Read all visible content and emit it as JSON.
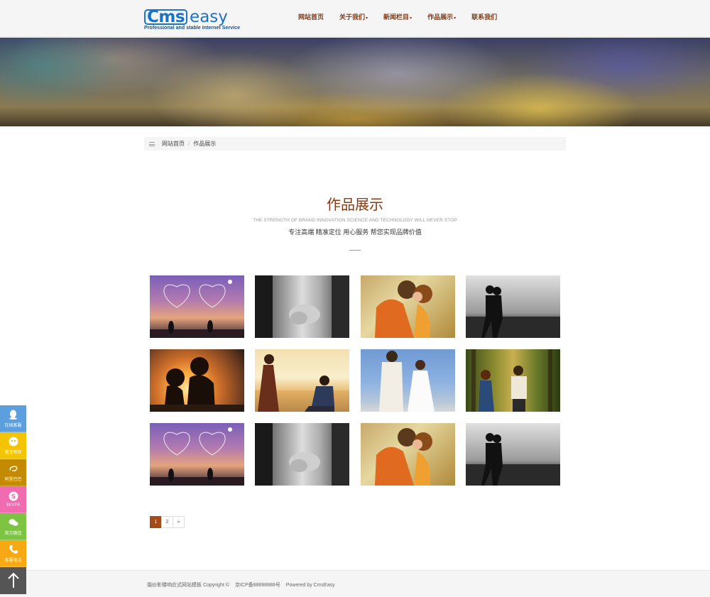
{
  "logo": {
    "brand_main": "Cms",
    "brand_accent": "easy",
    "tagline": "Professional and stable Internet Service"
  },
  "nav": [
    {
      "label": "网站首页",
      "dropdown": false
    },
    {
      "label": "关于我们",
      "dropdown": true
    },
    {
      "label": "新闻栏目",
      "dropdown": true
    },
    {
      "label": "作品展示",
      "dropdown": true
    },
    {
      "label": "联系我们",
      "dropdown": false
    }
  ],
  "breadcrumb": {
    "home": "网站首页",
    "separator": "/",
    "current": "作品展示"
  },
  "section": {
    "title": "作品展示",
    "subtitle_en": "THE STRENGTH OF BRAND INNOVATION SCIENCE AND TECHNOLOGY WILL NEVER STOP",
    "subtitle_cn": "专注高端 精准定位 用心服务 帮您实现品牌价值"
  },
  "gallery": [
    {
      "image": "heart-sparkler-silhouettes"
    },
    {
      "image": "holding-hands-monochrome"
    },
    {
      "image": "couple-kiss-orange-shirt"
    },
    {
      "image": "beach-couple-monochrome"
    },
    {
      "image": "sunset-couple-silhouette"
    },
    {
      "image": "proposal-at-sunset"
    },
    {
      "image": "wedding-couple-blue-sky"
    },
    {
      "image": "couple-in-forest"
    },
    {
      "image": "heart-sparkler-silhouettes"
    },
    {
      "image": "holding-hands-monochrome"
    },
    {
      "image": "couple-kiss-orange-shirt"
    },
    {
      "image": "beach-couple-monochrome"
    }
  ],
  "pagination": {
    "pages": [
      "1",
      "2"
    ],
    "current": "1",
    "next": "»"
  },
  "footer": {
    "site_name": "婚纱影楼响应式网站模板 Copyright ©",
    "icp": "京ICP备88888888号",
    "powered": "Powered by CmsEasy"
  },
  "side_toolbar": [
    {
      "label": "在线客服",
      "icon": "qq-icon",
      "color": "#5b9fdf"
    },
    {
      "label": "淘宝旺旺",
      "icon": "wangwang-icon",
      "color": "#f5c400"
    },
    {
      "label": "阿里巴巴",
      "icon": "alibaba-icon",
      "color": "#c58b00"
    },
    {
      "label": "SKYPE",
      "icon": "skype-icon",
      "color": "#f06bb0"
    },
    {
      "label": "官方微信",
      "icon": "wechat-icon",
      "color": "#7dc443"
    },
    {
      "label": "客服电话",
      "icon": "phone-icon",
      "color": "#f7a813"
    }
  ],
  "back_to_top": {
    "icon": "arrow-up-icon",
    "color": "#555555"
  },
  "colors": {
    "accent": "#a54b17",
    "nav_text": "#7b3a1a",
    "logo_blue": "#1a73c9"
  }
}
